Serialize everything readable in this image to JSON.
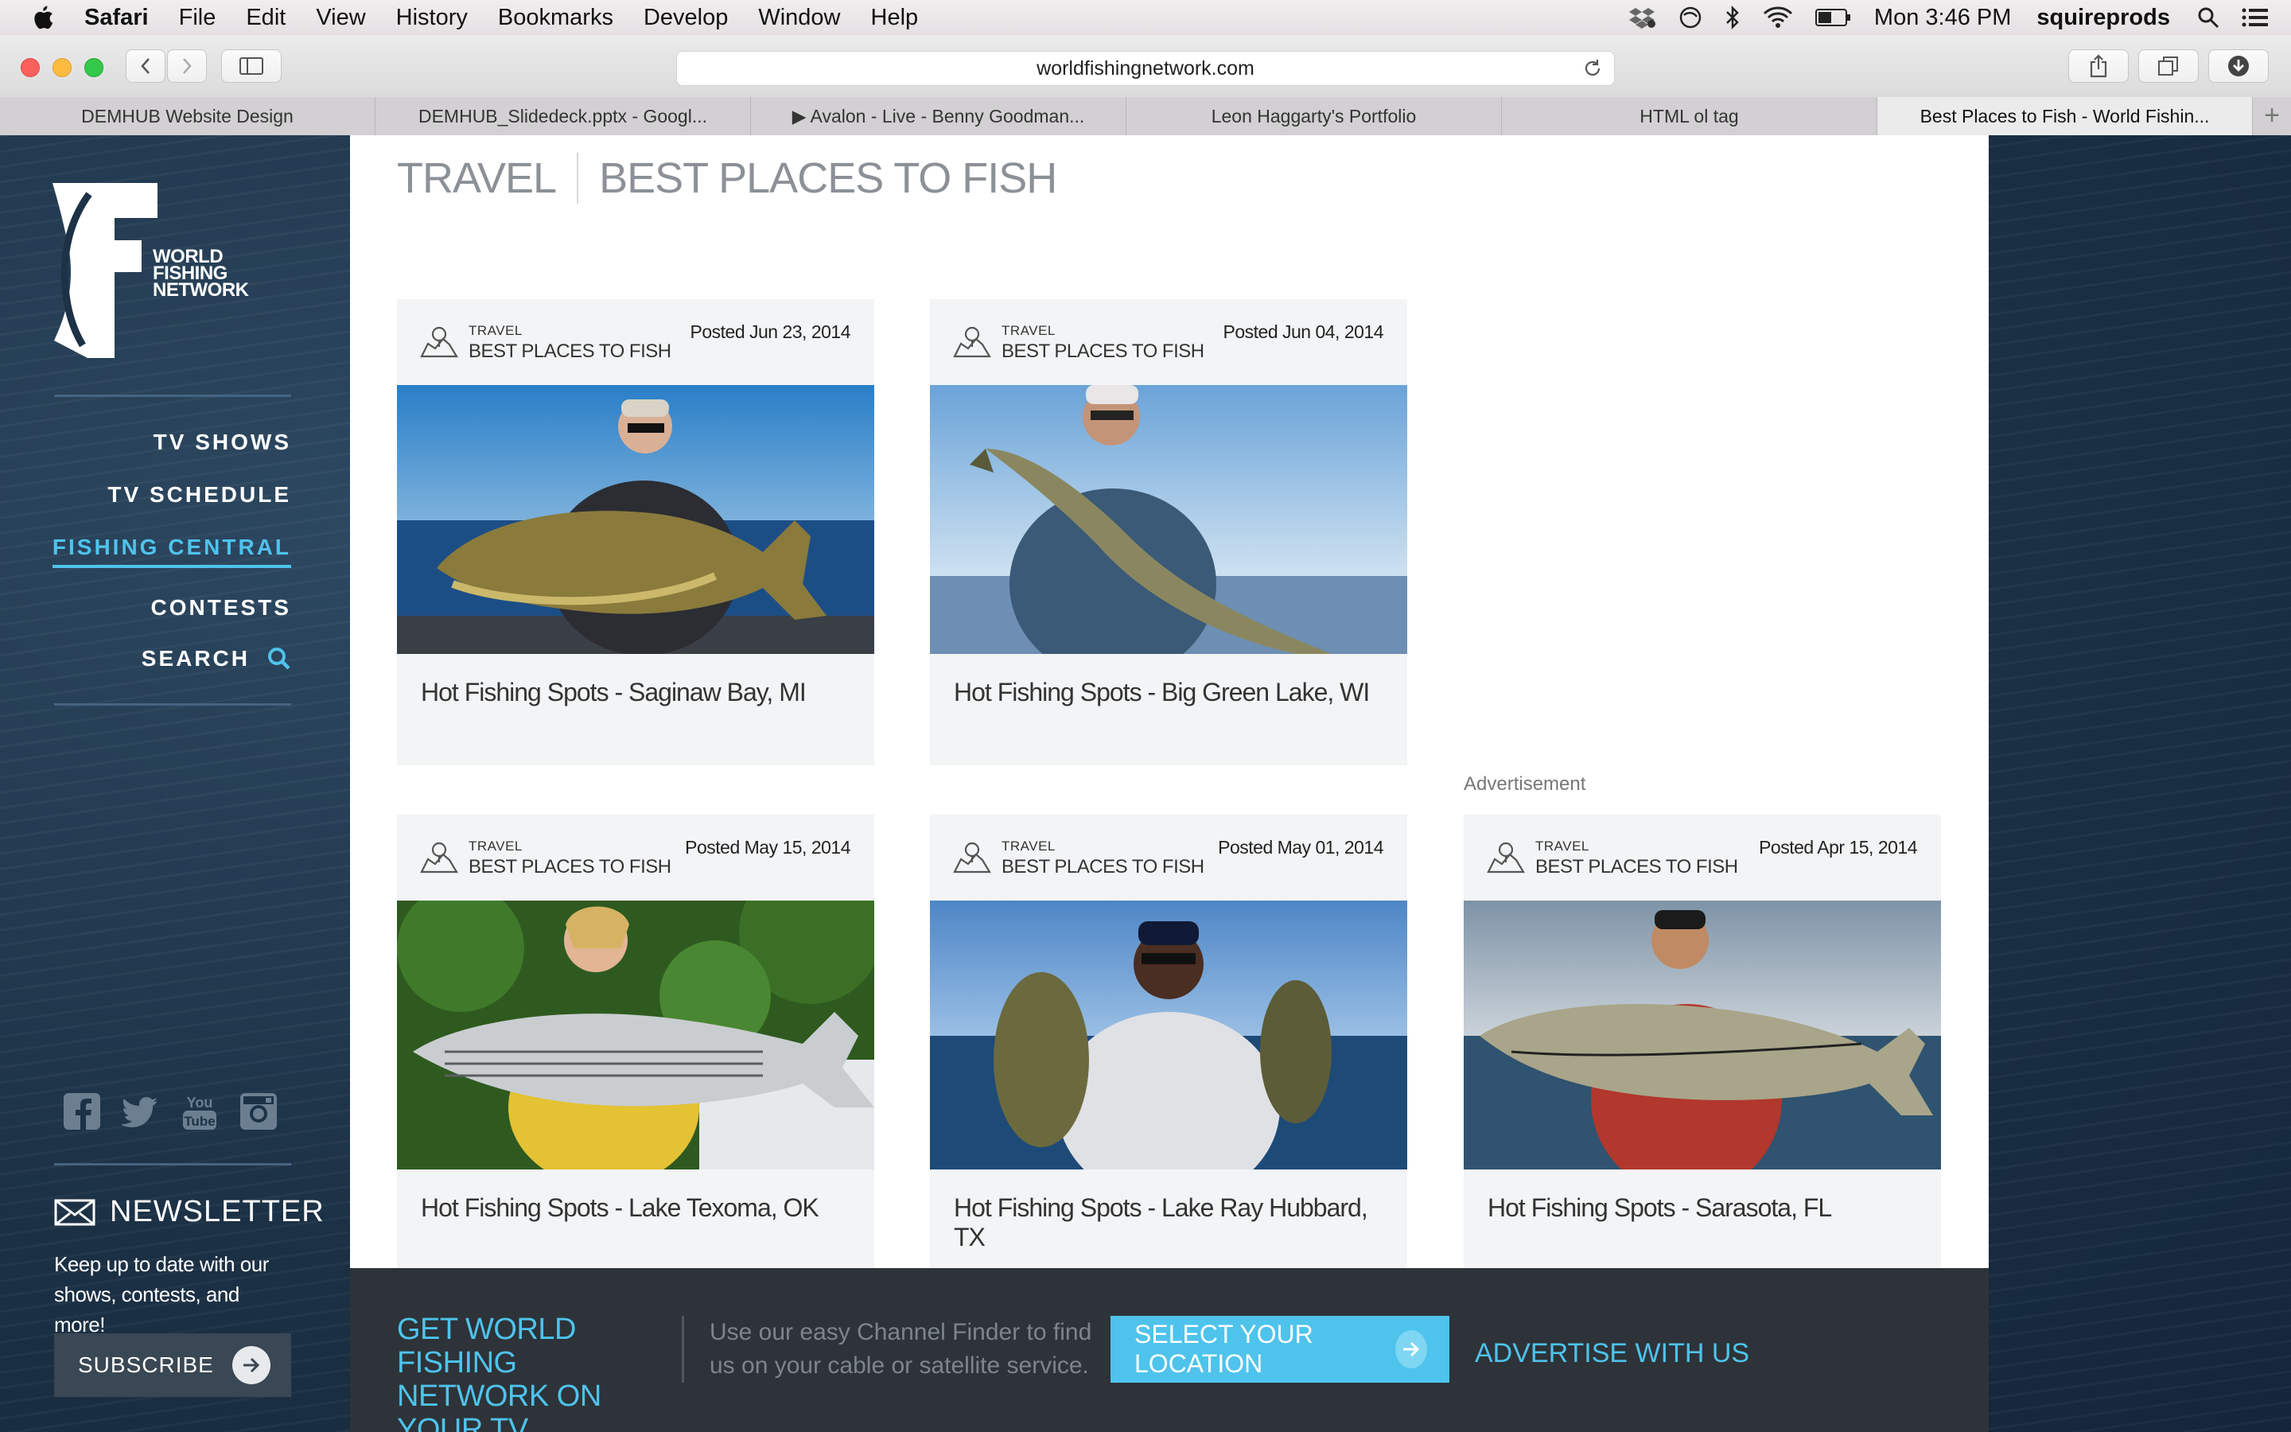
{
  "menubar": {
    "app_name": "Safari",
    "menus": [
      "File",
      "Edit",
      "View",
      "History",
      "Bookmarks",
      "Develop",
      "Window",
      "Help"
    ],
    "clock": "Mon 3:46 PM",
    "user": "squireprods"
  },
  "toolbar": {
    "url": "worldfishingnetwork.com"
  },
  "tabs": [
    {
      "label": "DEMHUB Website Design"
    },
    {
      "label": "DEMHUB_Slidedeck.pptx - Googl..."
    },
    {
      "label": "▶ Avalon - Live - Benny Goodman..."
    },
    {
      "label": "Leon Haggarty's Portfolio"
    },
    {
      "label": "HTML ol tag"
    },
    {
      "label": "Best Places to Fish - World Fishin..."
    }
  ],
  "tab_add": "+",
  "sidebar": {
    "logo_text": [
      "WORLD",
      "FISHING",
      "NETWORK"
    ],
    "nav": [
      {
        "label": "TV SHOWS"
      },
      {
        "label": "TV SCHEDULE"
      },
      {
        "label": "FISHING CENTRAL"
      },
      {
        "label": "CONTESTS"
      },
      {
        "label": "SEARCH"
      }
    ],
    "social_icons": [
      "facebook-icon",
      "twitter-icon",
      "youtube-icon",
      "instagram-icon"
    ],
    "newsletter": {
      "title": "NEWSLETTER",
      "text": "Keep up to date with our shows, contests, and more!",
      "button": "SUBSCRIBE"
    }
  },
  "main": {
    "breadcrumb": [
      "TRAVEL",
      "BEST PLACES TO FISH"
    ],
    "ad_label": "Advertisement",
    "cards": [
      {
        "cat1": "TRAVEL",
        "cat2": "BEST PLACES TO FISH",
        "date": "Posted Jun 23, 2014",
        "title": "Hot Fishing Spots - Saginaw Bay, MI"
      },
      {
        "cat1": "TRAVEL",
        "cat2": "BEST PLACES TO FISH",
        "date": "Posted Jun 04, 2014",
        "title": "Hot Fishing Spots - Big Green Lake, WI"
      },
      {
        "cat1": "TRAVEL",
        "cat2": "BEST PLACES TO FISH",
        "date": "Posted May 15, 2014",
        "title": "Hot Fishing Spots - Lake Texoma, OK"
      },
      {
        "cat1": "TRAVEL",
        "cat2": "BEST PLACES TO FISH",
        "date": "Posted May 01, 2014",
        "title": "Hot Fishing Spots - Lake Ray Hubbard, TX"
      },
      {
        "cat1": "TRAVEL",
        "cat2": "BEST PLACES TO FISH",
        "date": "Posted Apr 15, 2014",
        "title": "Hot Fishing Spots - Sarasota, FL"
      }
    ]
  },
  "footer": {
    "title": "GET WORLD FISHING NETWORK ON YOUR TV",
    "text": "Use our easy Channel Finder to find us on your cable or satellite service.",
    "button": "SELECT YOUR LOCATION",
    "advertise": "ADVERTISE WITH US"
  },
  "colors": {
    "accent": "#4ec3ec",
    "sidebar_bg": "#1d3246",
    "footer_bg": "#2d3338",
    "card_bg": "#f3f4f6"
  }
}
